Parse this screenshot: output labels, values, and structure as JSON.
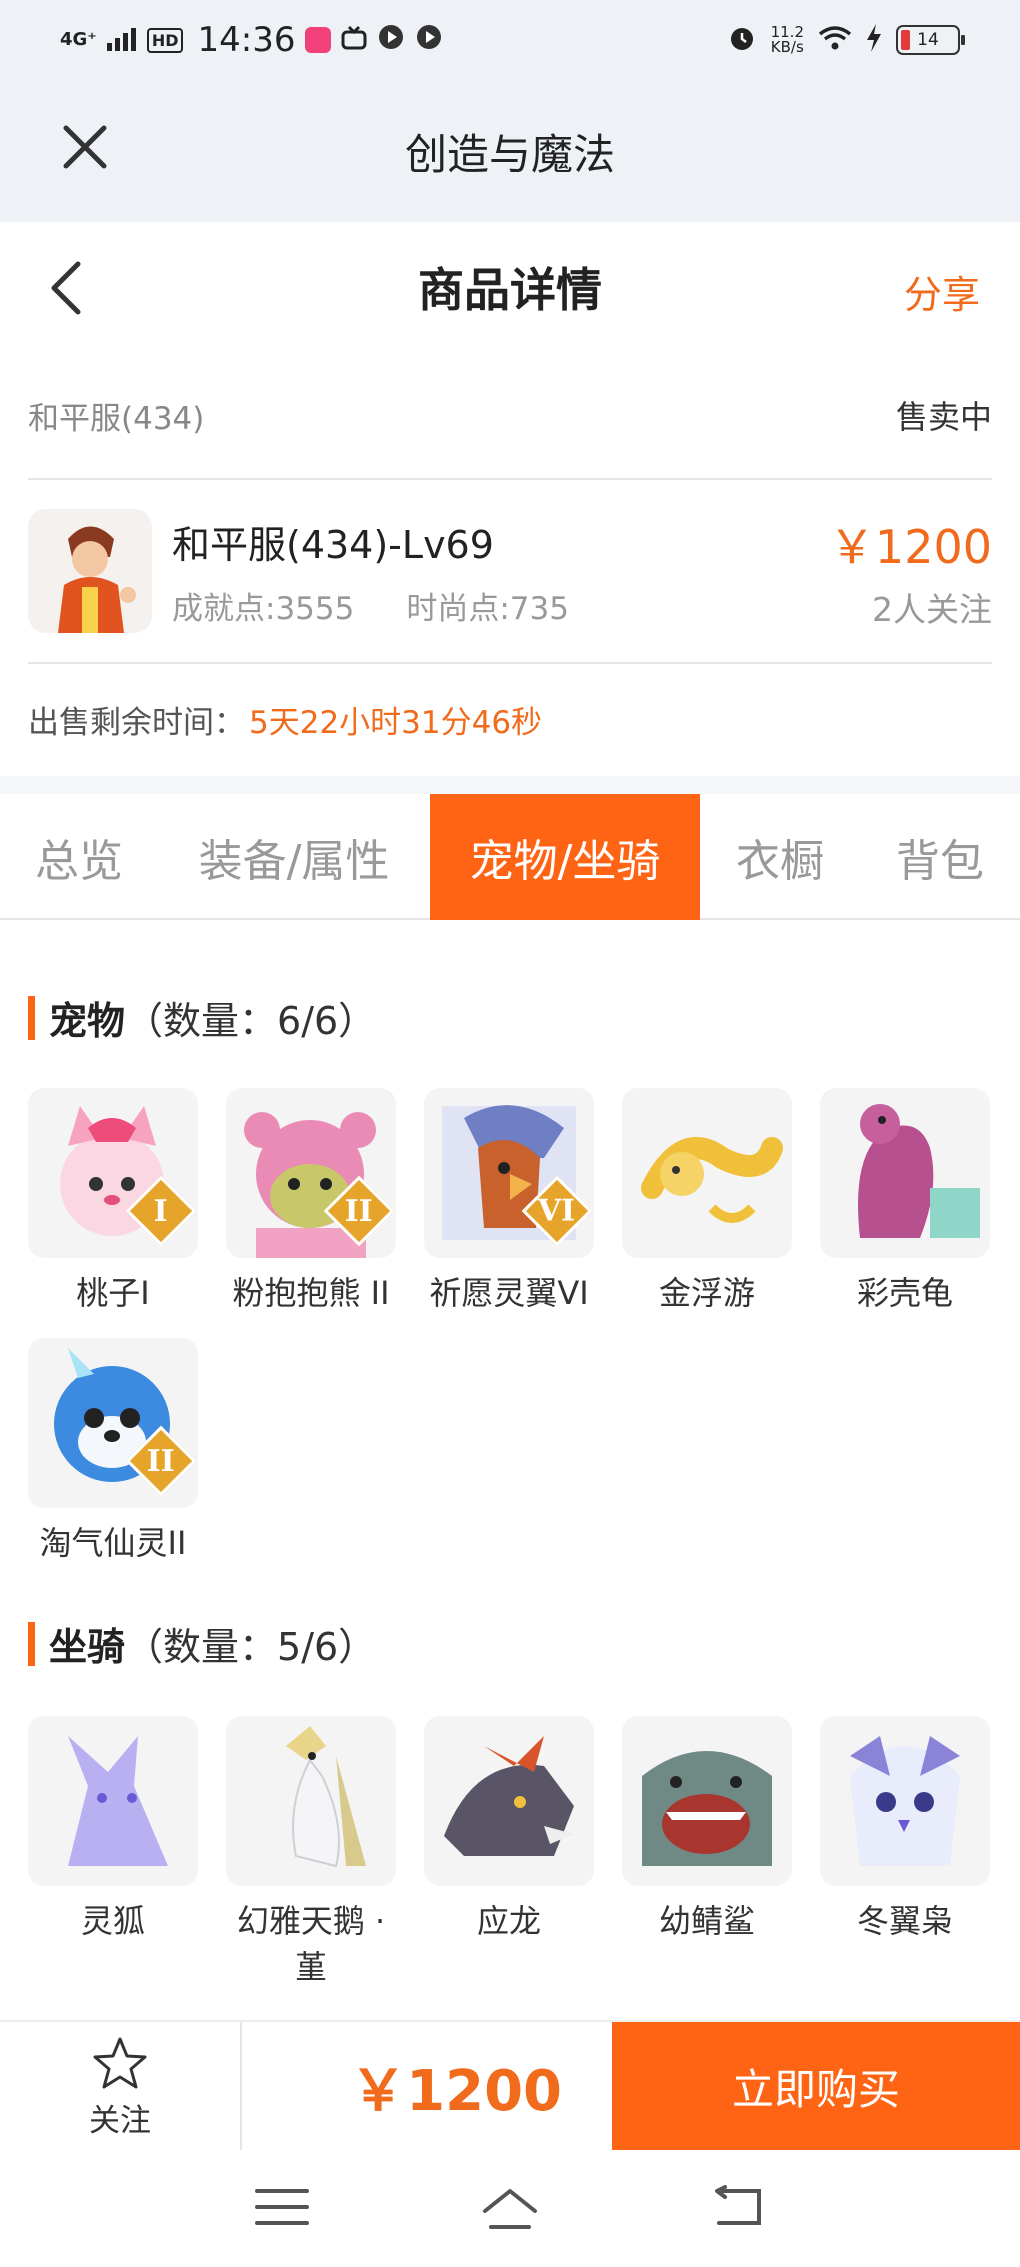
{
  "status_bar": {
    "network": "4G⁺",
    "hd": "HD",
    "time": "14:36",
    "speed_value": "11.2",
    "speed_unit": "KB/s",
    "battery": "14",
    "app_dot_colors": [
      "#f2417a",
      "#444444",
      "#444444",
      "#444444"
    ]
  },
  "app_header": {
    "title": "创造与魔法",
    "close_icon": "close-icon"
  },
  "nav": {
    "title": "商品详情",
    "share_label": "分享",
    "back_icon": "back-arrow-icon"
  },
  "product": {
    "server": "和平服(434)",
    "status": "售卖中",
    "title": "和平服(434)-Lv69",
    "achievement": "成就点:3555",
    "fashion": "时尚点:735",
    "price": "￥1200",
    "followers": "2人关注",
    "remaining_label": "出售剩余时间：",
    "remaining_value": "5天22小时31分46秒"
  },
  "tabs": [
    {
      "label": "总览",
      "active": false
    },
    {
      "label": "装备/属性",
      "active": false
    },
    {
      "label": "宠物/坐骑",
      "active": true
    },
    {
      "label": "衣橱",
      "active": false
    },
    {
      "label": "背包",
      "active": false
    }
  ],
  "pets": {
    "title": "宠物",
    "count": "（数量：6/6）",
    "items": [
      {
        "name": "桃子I",
        "badge": "I",
        "color": "#f7a3c0"
      },
      {
        "name": "粉抱抱熊 II",
        "badge": "II",
        "color": "#e98bb5"
      },
      {
        "name": "祈愿灵翼VI",
        "badge": "VI",
        "color": "#6e7fc4"
      },
      {
        "name": "金浮游",
        "badge": "",
        "color": "#f1c03a"
      },
      {
        "name": "彩壳龟",
        "badge": "",
        "color": "#b7508e"
      },
      {
        "name": "淘气仙灵II",
        "badge": "II",
        "color": "#3c8be0"
      }
    ]
  },
  "mounts": {
    "title": "坐骑",
    "count": "（数量：5/6）",
    "items": [
      {
        "name": "灵狐",
        "color": "#b9b0f2"
      },
      {
        "name": "幻雅天鹅 · 堇",
        "color": "#e8d58a"
      },
      {
        "name": "应龙",
        "color": "#5a5566"
      },
      {
        "name": "幼鲭鲨",
        "color": "#6f8a84"
      },
      {
        "name": "冬翼枭",
        "color": "#8a83d8"
      }
    ]
  },
  "bottom_bar": {
    "follow_label": "关注",
    "price": "￥1200",
    "buy_label": "立即购买"
  },
  "colors": {
    "accent": "#ff6314",
    "price": "#f06b1c"
  }
}
